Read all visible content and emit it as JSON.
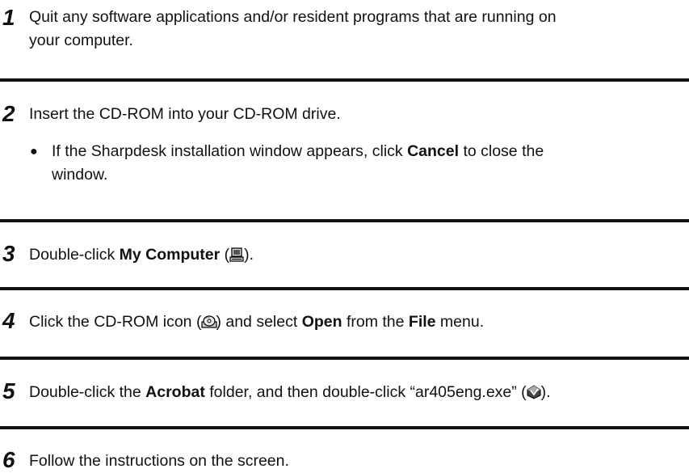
{
  "steps": [
    {
      "number": "1",
      "line1": "Quit any software applications and/or resident programs that are running on",
      "line2": "your computer."
    },
    {
      "number": "2",
      "text": "Insert the CD-ROM into your CD-ROM drive.",
      "bullet": {
        "pre": "If the Sharpdesk installation window appears, click ",
        "bold": "Cancel",
        "post": " to close the",
        "line2": "window."
      }
    },
    {
      "number": "3",
      "pre": "Double-click ",
      "bold": "My Computer",
      "open_paren": " (",
      "close_paren": ").",
      "icon": "my-computer-icon"
    },
    {
      "number": "4",
      "pre": "Click the CD-ROM icon (",
      "mid": ") and select ",
      "bold1": "Open",
      "mid2": " from the ",
      "bold2": "File",
      "post": " menu.",
      "icon": "cd-rom-icon"
    },
    {
      "number": "5",
      "pre": "Double-click the ",
      "bold": "Acrobat",
      "mid": " folder, and then double-click “ar405eng.exe” (",
      "post": ").",
      "icon": "installer-icon"
    },
    {
      "number": "6",
      "text": "Follow the instructions on the screen."
    }
  ]
}
